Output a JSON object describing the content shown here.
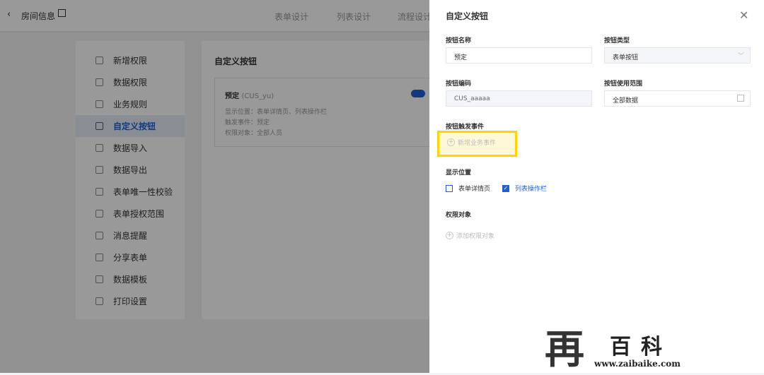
{
  "header": {
    "back_icon": "chevron-left-icon",
    "title": "房间信息",
    "edit_icon": "edit-icon",
    "tabs": [
      "表单设计",
      "列表设计",
      "流程设计"
    ]
  },
  "sidebar": {
    "items": [
      {
        "label": "新增权限",
        "icon": "add-permission-icon"
      },
      {
        "label": "数据权限",
        "icon": "shield-icon"
      },
      {
        "label": "业务规则",
        "icon": "sliders-icon"
      },
      {
        "label": "自定义按钮",
        "icon": "touch-icon",
        "active": true
      },
      {
        "label": "数据导入",
        "icon": "import-icon"
      },
      {
        "label": "数据导出",
        "icon": "export-icon"
      },
      {
        "label": "表单唯一性校验",
        "icon": "unique-icon"
      },
      {
        "label": "表单授权范围",
        "icon": "scope-icon"
      },
      {
        "label": "消息提醒",
        "icon": "clock-icon"
      },
      {
        "label": "分享表单",
        "icon": "share-icon"
      },
      {
        "label": "数据模板",
        "icon": "template-icon"
      },
      {
        "label": "打印设置",
        "icon": "print-icon"
      }
    ]
  },
  "main": {
    "title": "自定义按钮",
    "button_card": {
      "name": "预定",
      "code": "(CUS_yu)",
      "enabled": true,
      "lines": [
        "显示位置：表单详情页、列表操作栏",
        "触发事件：预定",
        "权限对象：全部人员"
      ]
    }
  },
  "drawer": {
    "title": "自定义按钮",
    "close_icon": "close-icon",
    "name_label": "按钮名称",
    "name_value": "预定",
    "type_label": "按钮类型",
    "type_value": "表单按钮",
    "code_label": "按钮编码",
    "code_value": "CUS_aaaaa",
    "scope_label": "按钮使用范围",
    "scope_value": "全部数据",
    "event_label": "按钮触发事件",
    "add_event": "新增业务事件",
    "position_label": "显示位置",
    "positions": [
      {
        "label": "表单详情页",
        "checked": false
      },
      {
        "label": "列表操作栏",
        "checked": true
      }
    ],
    "perm_label": "权限对象",
    "add_perm": "添加权限对象"
  },
  "watermark": {
    "logo": "再",
    "text": "百科",
    "url": "www.zaibaike.com"
  },
  "colors": {
    "accent": "#1f5fd6",
    "highlight": "#ffd400"
  }
}
